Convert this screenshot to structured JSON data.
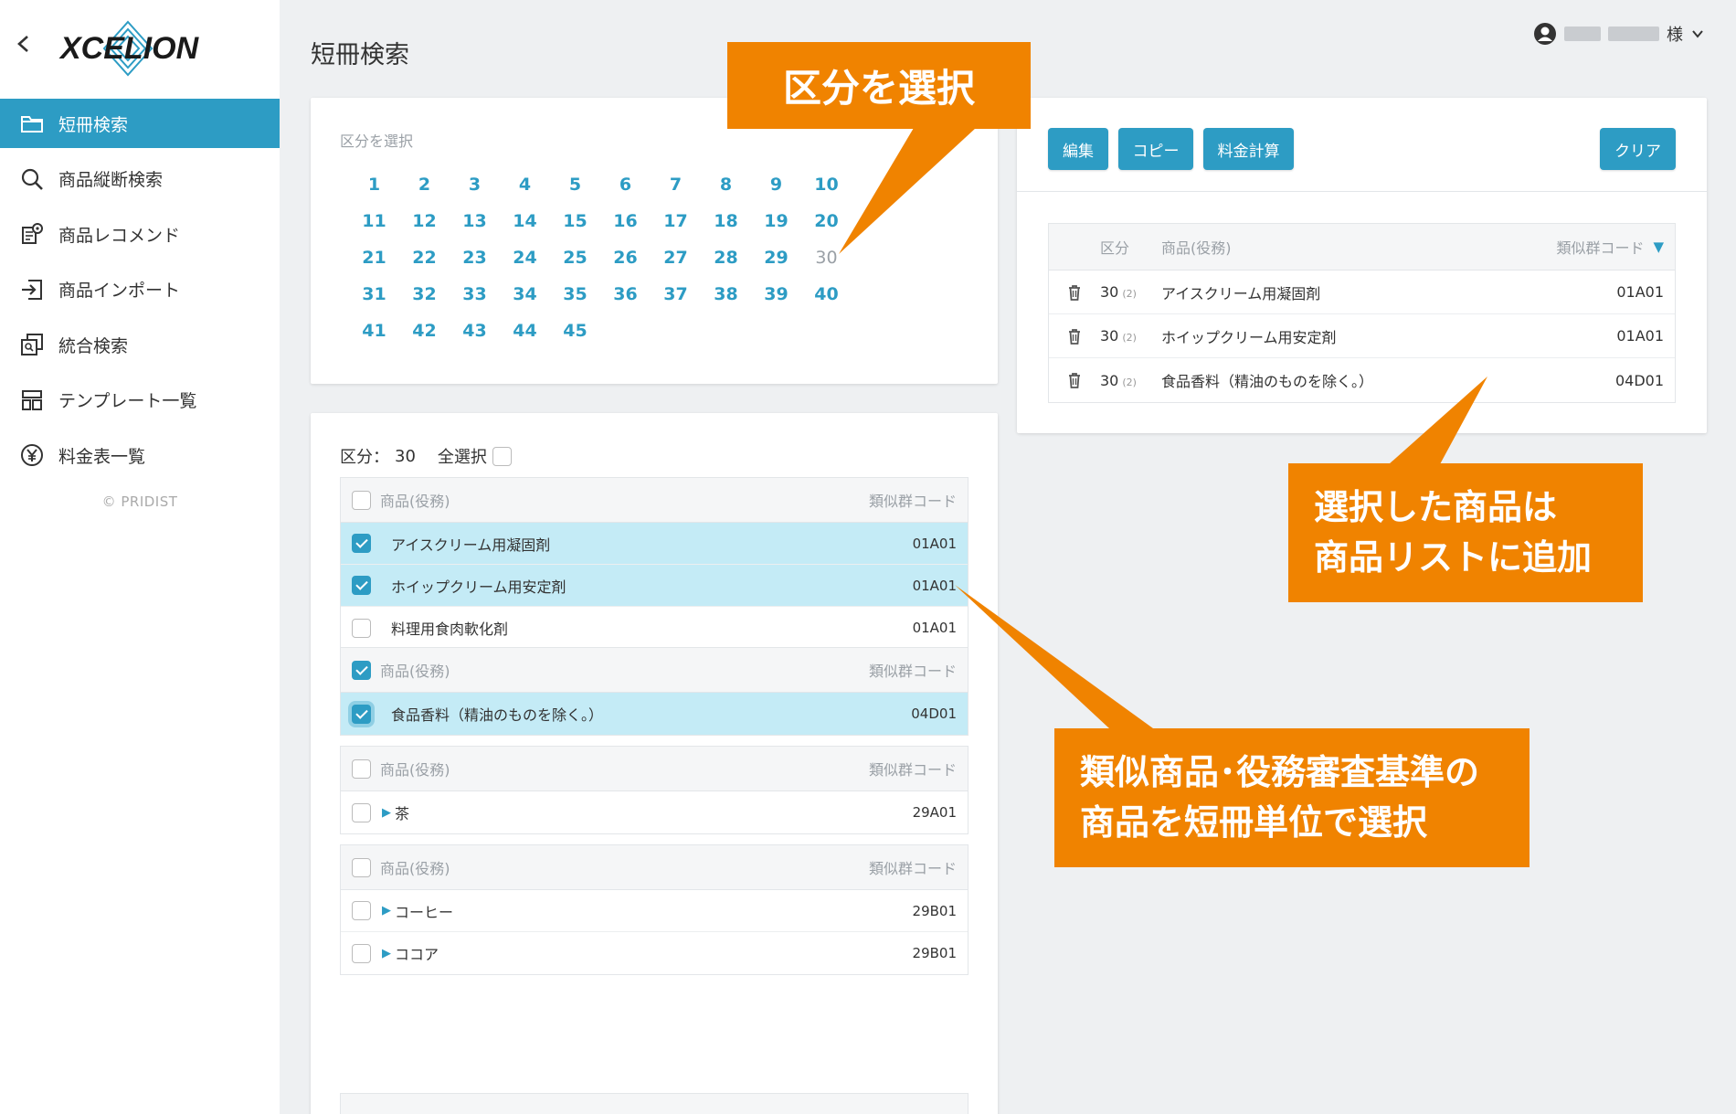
{
  "sidebar": {
    "logo_text": "XCELION",
    "items": [
      {
        "label": "短冊検索",
        "icon": "folder-icon",
        "active": true
      },
      {
        "label": "商品縦断検索",
        "icon": "search-icon"
      },
      {
        "label": "商品レコメンド",
        "icon": "recommend-icon"
      },
      {
        "label": "商品インポート",
        "icon": "import-icon"
      },
      {
        "label": "統合検索",
        "icon": "integrated-search-icon"
      },
      {
        "label": "テンプレート一覧",
        "icon": "template-icon"
      },
      {
        "label": "料金表一覧",
        "icon": "yen-icon"
      }
    ],
    "copyright": "© PRIDIST"
  },
  "header": {
    "title": "短冊検索",
    "user_suffix": "様"
  },
  "class_select": {
    "label": "区分を選択",
    "numbers": [
      "1",
      "2",
      "3",
      "4",
      "5",
      "6",
      "7",
      "8",
      "9",
      "10",
      "11",
      "12",
      "13",
      "14",
      "15",
      "16",
      "17",
      "18",
      "19",
      "20",
      "21",
      "22",
      "23",
      "24",
      "25",
      "26",
      "27",
      "28",
      "29",
      "30",
      "31",
      "32",
      "33",
      "34",
      "35",
      "36",
      "37",
      "38",
      "39",
      "40",
      "41",
      "42",
      "43",
      "44",
      "45"
    ],
    "selected": "30"
  },
  "list": {
    "class_label": "区分：",
    "class_value": "30",
    "select_all": "全選択",
    "groups": [
      {
        "head_product": "商品(役務)",
        "head_code": "類似群コード",
        "checked": false,
        "rows": [
          {
            "name": "アイスクリーム用凝固剤",
            "code": "01A01",
            "checked": true,
            "tri": false
          },
          {
            "name": "ホイップクリーム用安定剤",
            "code": "01A01",
            "checked": true,
            "tri": false
          },
          {
            "name": "料理用食肉軟化剤",
            "code": "01A01",
            "checked": false,
            "tri": false
          }
        ]
      },
      {
        "head_product": "商品(役務)",
        "head_code": "類似群コード",
        "checked": true,
        "rows": [
          {
            "name": "食品香料（精油のものを除く。）",
            "code": "04D01",
            "checked": true,
            "tri": false
          }
        ]
      },
      {
        "head_product": "商品(役務)",
        "head_code": "類似群コード",
        "checked": false,
        "rows": [
          {
            "name": "茶",
            "code": "29A01",
            "checked": false,
            "tri": true
          }
        ]
      },
      {
        "head_product": "商品(役務)",
        "head_code": "類似群コード",
        "checked": false,
        "rows": [
          {
            "name": "コーヒー",
            "code": "29B01",
            "checked": false,
            "tri": true
          },
          {
            "name": "ココア",
            "code": "29B01",
            "checked": false,
            "tri": true
          }
        ]
      }
    ]
  },
  "product_list": {
    "buttons": {
      "edit": "編集",
      "copy": "コピー",
      "calc": "料金計算",
      "clear": "クリア"
    },
    "columns": {
      "class": "区分",
      "product": "商品(役務)",
      "code": "類似群コード"
    },
    "rows": [
      {
        "class": "30",
        "sub": "(2)",
        "name": "アイスクリーム用凝固剤",
        "code": "01A01"
      },
      {
        "class": "30",
        "sub": "(2)",
        "name": "ホイップクリーム用安定剤",
        "code": "01A01"
      },
      {
        "class": "30",
        "sub": "(2)",
        "name": "食品香料（精油のものを除く。）",
        "code": "04D01"
      }
    ]
  },
  "callouts": {
    "select_class": "区分を選択",
    "added_to_list": "選択した商品は\n商品リストに追加",
    "select_by_strip": "類似商品･役務審査基準の\n商品を短冊単位で選択"
  },
  "colors": {
    "accent": "#2d9cc4",
    "callout": "#f08300",
    "selected_row": "#c4ebf6"
  }
}
